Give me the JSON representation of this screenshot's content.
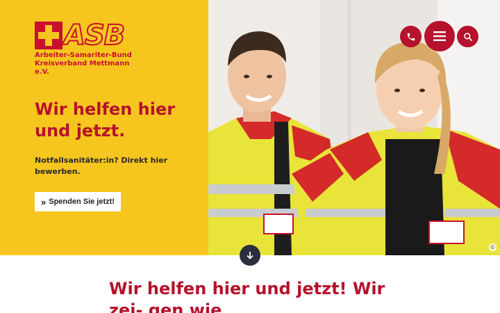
{
  "brand": {
    "logo_text": "ASB",
    "org_lines": [
      "Arbeiter-Samariter-Bund",
      "Kreisverband Mettmann",
      "e.V."
    ]
  },
  "hero": {
    "headline_lines": [
      "Wir helfen hier",
      "und jetzt."
    ],
    "teaser": "Notfallsanitäter:in? Direkt hier bewerben.",
    "donate_label": "Spenden Sie jetzt!",
    "image_badge": "©"
  },
  "header_actions": {
    "phone_icon": "phone-icon",
    "menu_icon": "hamburger-menu-icon",
    "search_icon": "search-icon"
  },
  "scroll": {
    "icon": "arrow-down-icon"
  },
  "section": {
    "title": "Wir helfen hier und jetzt! Wir zei- gen wie"
  },
  "colors": {
    "brand_yellow": "#f6c61e",
    "brand_red": "#b5122b",
    "logo_red": "#c8102e",
    "scroll_button": "#2d2e3d"
  }
}
